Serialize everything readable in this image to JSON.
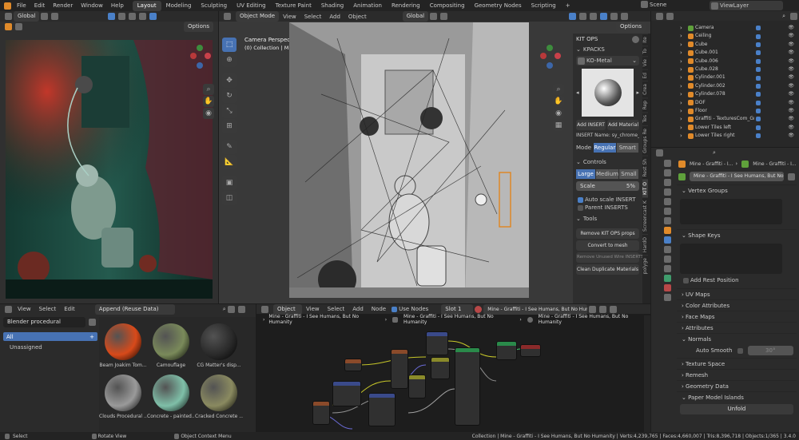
{
  "topbar": {
    "menus": [
      "File",
      "Edit",
      "Render",
      "Window",
      "Help"
    ],
    "workspaces": [
      "Layout",
      "Modeling",
      "Sculpting",
      "UV Editing",
      "Texture Paint",
      "Shading",
      "Animation",
      "Rendering",
      "Compositing",
      "Geometry Nodes",
      "Scripting"
    ],
    "active_workspace": "Layout",
    "scene": "Scene",
    "view_layer": "ViewLayer"
  },
  "left_viewport": {
    "transform": "Global",
    "options": "Options"
  },
  "main_viewport": {
    "mode": "Object Mode",
    "menus": [
      "View",
      "Select",
      "Add",
      "Object"
    ],
    "transform": "Global",
    "options": "Options",
    "camera_title": "Camera Perspective",
    "camera_sub": "(0) Collection | Mine - Graffiti - I See Humans, But No Humanity"
  },
  "kitops": {
    "title": "KIT OPS",
    "kpacks": "KPACKS",
    "pack": "KO-Metal",
    "add_insert": "Add INSERT",
    "add_material": "Add Material",
    "insert_name": "INSERT Name: sy_chrome_matte",
    "mode_label": "Mode",
    "mode_regular": "Regular",
    "mode_smart": "Smart",
    "controls": "Controls",
    "size_large": "Large",
    "size_medium": "Medium",
    "size_small": "Small",
    "scale_label": "Scale",
    "scale_value": "5%",
    "auto_scale": "Auto scale INSERT",
    "parent_inserts": "Parent INSERTS",
    "tools": "Tools",
    "remove_props": "Remove KIT OPS props",
    "convert_mesh": "Convert to mesh",
    "remove_unused": "Remove Unused Wire INSERTS",
    "clean_dup": "Clean Duplicate Materials"
  },
  "sidebar_tabs": [
    "Ite",
    "To",
    "Vie",
    "Ed",
    "Crea",
    "Rep",
    "Tes",
    "Groups Re",
    "Rest Sh",
    "KIT O",
    "Screencast K",
    "HardO",
    "polyge"
  ],
  "outliner": {
    "items": [
      {
        "name": "Camera",
        "icon": "camera"
      },
      {
        "name": "Ceiling",
        "icon": "mesh"
      },
      {
        "name": "Cube",
        "icon": "mesh"
      },
      {
        "name": "Cube.001",
        "icon": "mesh"
      },
      {
        "name": "Cube.006",
        "icon": "mesh"
      },
      {
        "name": "Cube.028",
        "icon": "mesh"
      },
      {
        "name": "Cylinder.001",
        "icon": "mesh"
      },
      {
        "name": "Cylinder.002",
        "icon": "mesh"
      },
      {
        "name": "Cylinder.078",
        "icon": "mesh"
      },
      {
        "name": "DOF",
        "icon": "empty"
      },
      {
        "name": "Floor",
        "icon": "mesh"
      },
      {
        "name": "Graffiti - TexturesCom_GraffitiTags0",
        "icon": "mesh"
      },
      {
        "name": "Lower Tiles left",
        "icon": "mesh"
      },
      {
        "name": "Lower Tiles right",
        "icon": "mesh"
      }
    ]
  },
  "properties": {
    "object_name": "Mine - Graffiti - I...",
    "mesh_name": "Mine - Graffiti - I...",
    "data_name": "Mine - Graffiti - I See Humans, But No Hu",
    "vertex_groups": "Vertex Groups",
    "shape_keys": "Shape Keys",
    "add_rest": "Add Rest Position",
    "uv_maps": "UV Maps",
    "color_attributes": "Color Attributes",
    "face_maps": "Face Maps",
    "attributes": "Attributes",
    "normals": "Normals",
    "auto_smooth": "Auto Smooth",
    "auto_smooth_value": "30°",
    "texture_space": "Texture Space",
    "remesh": "Remesh",
    "geometry_data": "Geometry Data",
    "paper_model": "Paper Model Islands",
    "unfold": "Unfold"
  },
  "asset_browser": {
    "menus": [
      "View",
      "Select",
      "Edit"
    ],
    "import_mode": "Append (Reuse Data)",
    "library": "Blender procedural",
    "catalog_all": "All",
    "catalog_unassigned": "Unassigned",
    "assets": [
      {
        "name": "Beam Joakim Tom...",
        "color": "#d84a1a"
      },
      {
        "name": "Camouflage",
        "color": "#7a8a5a"
      },
      {
        "name": "CG Matter's disp...",
        "color": "#2a2a2a"
      },
      {
        "name": "Clouds Procedural ...",
        "color": "#9a9a9a"
      },
      {
        "name": "Concrete - painted...",
        "color": "#7fbfa8"
      },
      {
        "name": "Cracked Concrete ...",
        "color": "#8a8a60"
      }
    ]
  },
  "node_editor": {
    "type": "Object",
    "menus": [
      "View",
      "Select",
      "Add",
      "Node"
    ],
    "use_nodes": "Use Nodes",
    "slot": "Slot 1",
    "material": "Mine - Graffiti - I See Humans, But No Humanity",
    "breadcrumb": [
      "Mine - Graffiti - I See Humans, But No Humanity",
      "Mine - Graffiti - I See Humans, But No Humanity",
      "Mine - Graffiti - I See Humans, But No Humanity"
    ]
  },
  "statusbar": {
    "select": "Select",
    "rotate": "Rotate View",
    "context": "Object Context Menu",
    "stats": "Collection | Mine - Graffiti - I See Humans, But No Humanity | Verts:4,239,765 | Faces:4,660,007 | Tris:8,396,718 | Objects:1/365 | 3.4.0"
  }
}
